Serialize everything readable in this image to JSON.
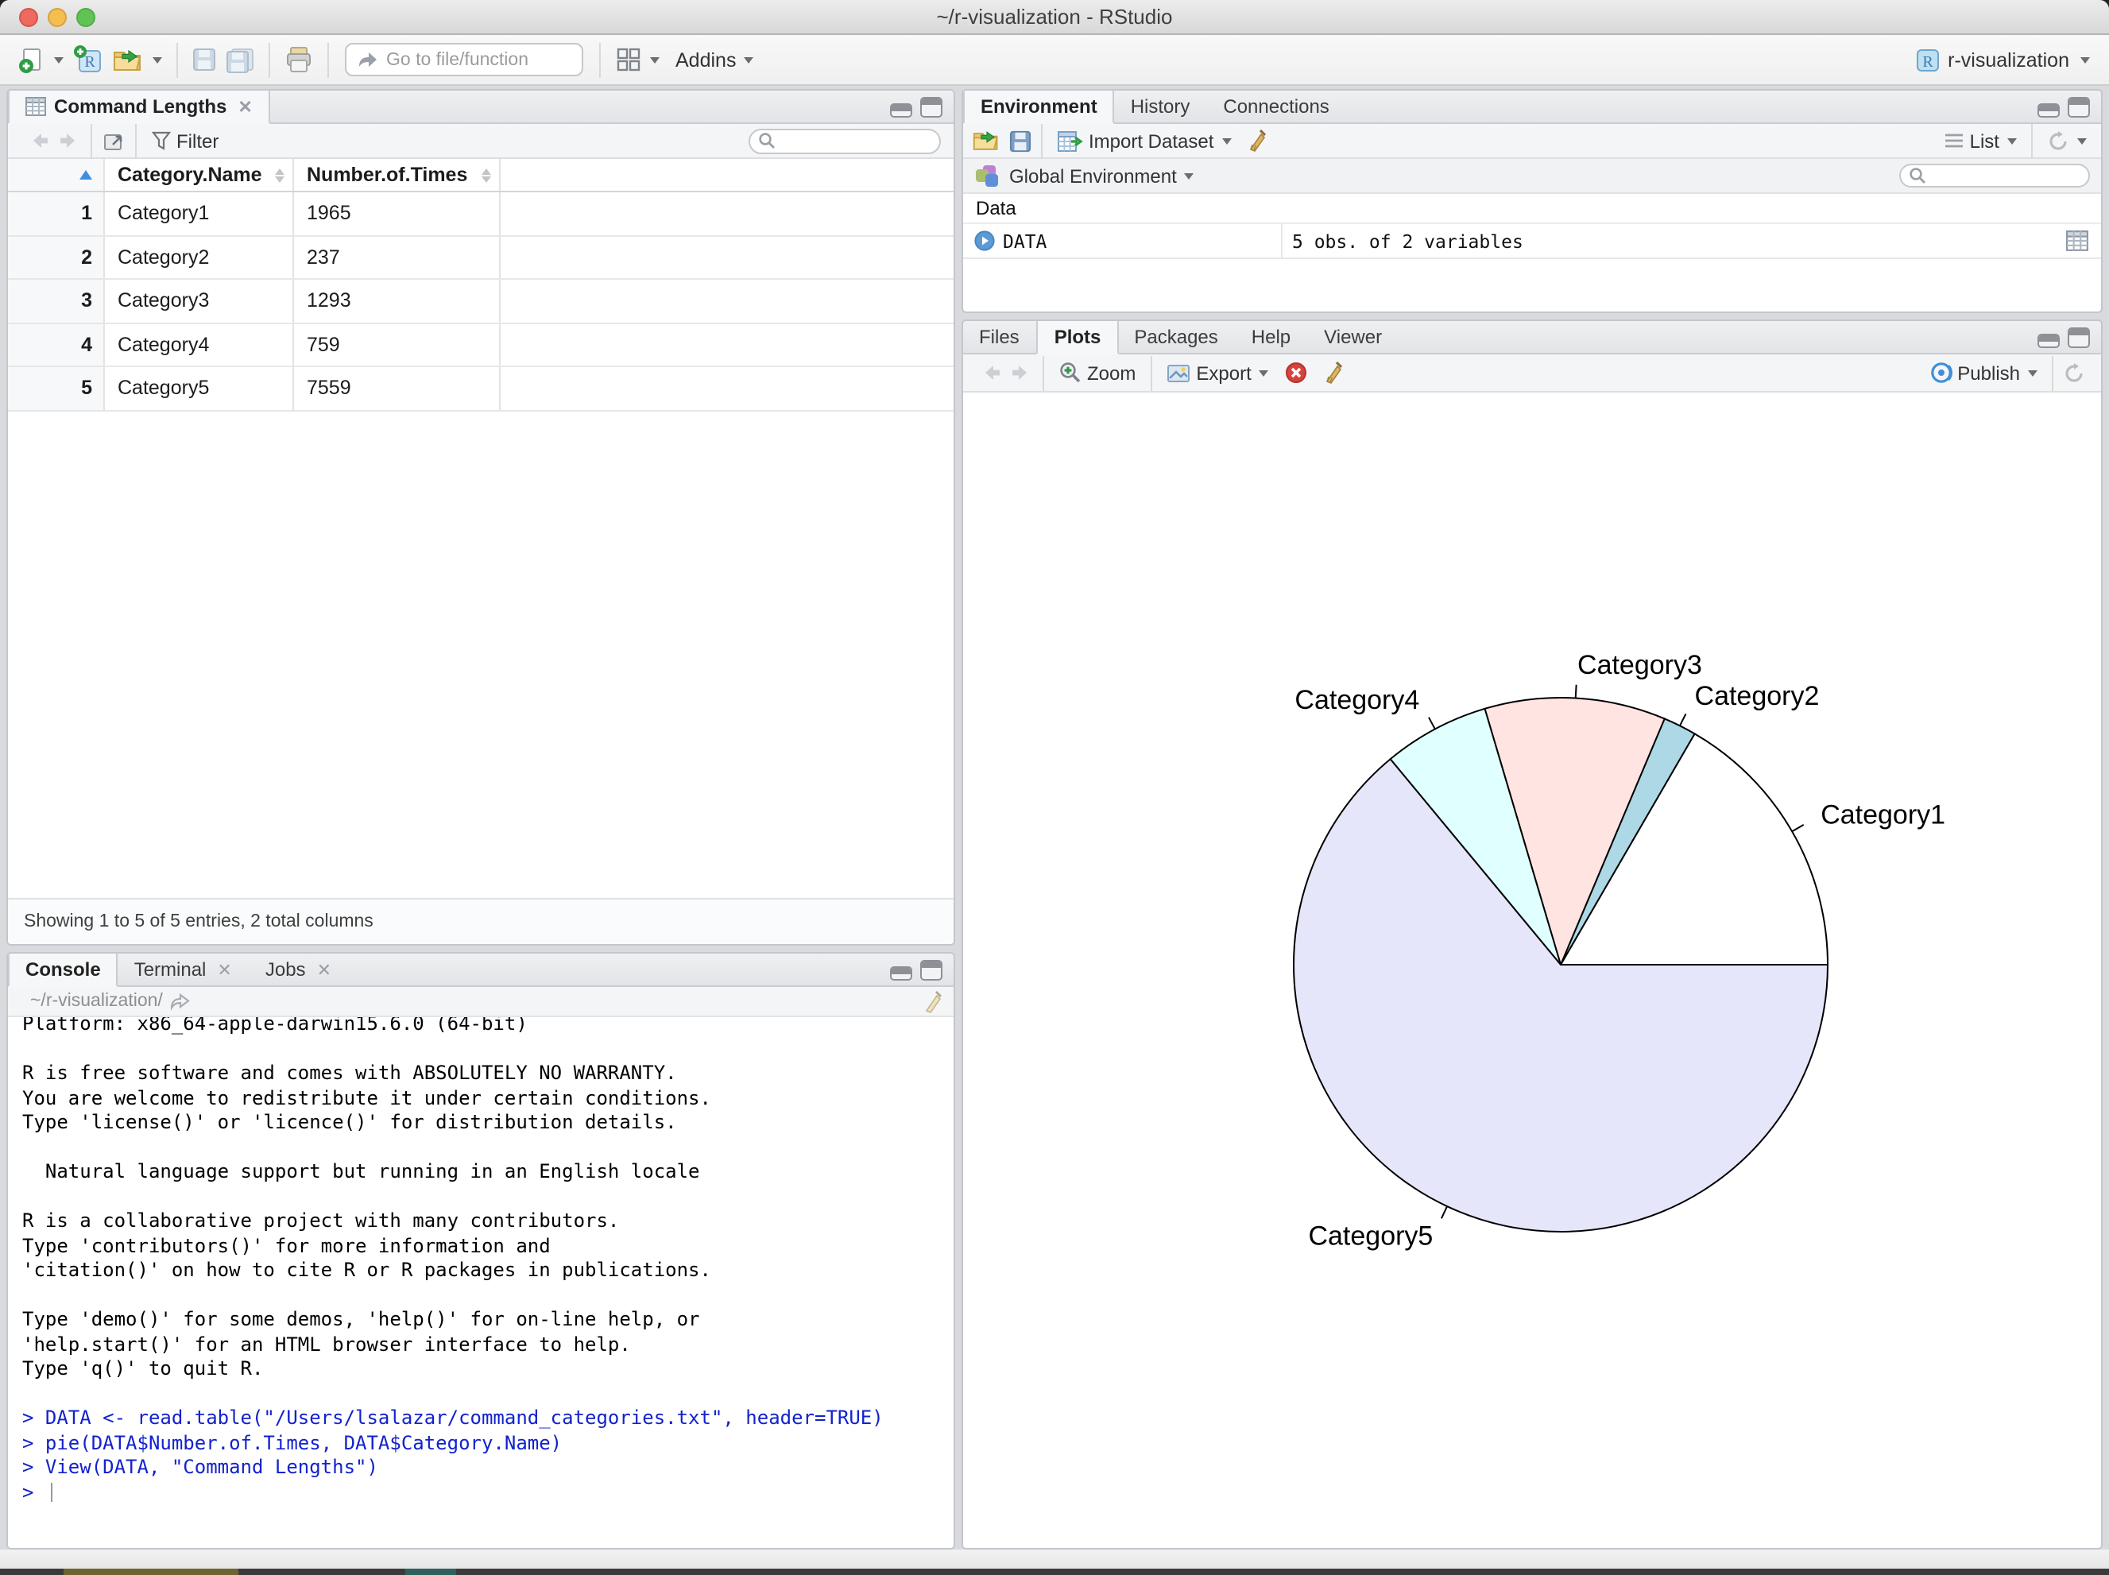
{
  "window": {
    "title": "~/r-visualization - RStudio"
  },
  "toolbar": {
    "goto_placeholder": "Go to file/function",
    "addins_label": "Addins",
    "project_label": "r-visualization"
  },
  "viewer_pane": {
    "tab": "Command Lengths",
    "filter_label": "Filter",
    "columns": [
      "Category.Name",
      "Number.of.Times"
    ],
    "rows": [
      {
        "n": "1",
        "name": "Category1",
        "times": "1965"
      },
      {
        "n": "2",
        "name": "Category2",
        "times": "237"
      },
      {
        "n": "3",
        "name": "Category3",
        "times": "1293"
      },
      {
        "n": "4",
        "name": "Category4",
        "times": "759"
      },
      {
        "n": "5",
        "name": "Category5",
        "times": "7559"
      }
    ],
    "status": "Showing 1 to 5 of 5 entries, 2 total columns"
  },
  "environment_pane": {
    "tabs": [
      "Environment",
      "History",
      "Connections"
    ],
    "import_label": "Import Dataset",
    "list_label": "List",
    "scope_label": "Global Environment",
    "section_label": "Data",
    "objects": [
      {
        "name": "DATA",
        "desc": "5 obs. of 2 variables"
      }
    ]
  },
  "plots_pane": {
    "tabs": [
      "Files",
      "Plots",
      "Packages",
      "Help",
      "Viewer"
    ],
    "zoom_label": "Zoom",
    "export_label": "Export",
    "publish_label": "Publish"
  },
  "console_pane": {
    "tabs": [
      "Console",
      "Terminal",
      "Jobs"
    ],
    "working_dir": "~/r-visualization/",
    "input_color": "#1322cd",
    "lines": [
      {
        "t": "o",
        "text": "Platform: x86_64-apple-darwin15.6.0 (64-bit)"
      },
      {
        "t": "o",
        "text": ""
      },
      {
        "t": "o",
        "text": "R is free software and comes with ABSOLUTELY NO WARRANTY."
      },
      {
        "t": "o",
        "text": "You are welcome to redistribute it under certain conditions."
      },
      {
        "t": "o",
        "text": "Type 'license()' or 'licence()' for distribution details."
      },
      {
        "t": "o",
        "text": ""
      },
      {
        "t": "o",
        "text": "  Natural language support but running in an English locale"
      },
      {
        "t": "o",
        "text": ""
      },
      {
        "t": "o",
        "text": "R is a collaborative project with many contributors."
      },
      {
        "t": "o",
        "text": "Type 'contributors()' for more information and"
      },
      {
        "t": "o",
        "text": "'citation()' on how to cite R or R packages in publications."
      },
      {
        "t": "o",
        "text": ""
      },
      {
        "t": "o",
        "text": "Type 'demo()' for some demos, 'help()' for on-line help, or"
      },
      {
        "t": "o",
        "text": "'help.start()' for an HTML browser interface to help."
      },
      {
        "t": "o",
        "text": "Type 'q()' to quit R."
      },
      {
        "t": "o",
        "text": ""
      },
      {
        "t": "i",
        "text": "> DATA <- read.table(\"/Users/lsalazar/command_categories.txt\", header=TRUE)"
      },
      {
        "t": "i",
        "text": "> pie(DATA$Number.of.Times, DATA$Category.Name)"
      },
      {
        "t": "i",
        "text": "> View(DATA, \"Command Lengths\")"
      },
      {
        "t": "p",
        "text": "> "
      }
    ]
  },
  "chart_data": {
    "type": "pie",
    "labels": [
      "Category1",
      "Category2",
      "Category3",
      "Category4",
      "Category5"
    ],
    "values": [
      1965,
      237,
      1293,
      759,
      7559
    ],
    "colors": [
      "#ffffff",
      "#add8e6",
      "#ffe4e1",
      "#e0ffff",
      "#e6e6fa"
    ],
    "stroke": "#000000",
    "start_angle_deg": 0,
    "direction": "counterclockwise",
    "title": "",
    "legend": false
  }
}
